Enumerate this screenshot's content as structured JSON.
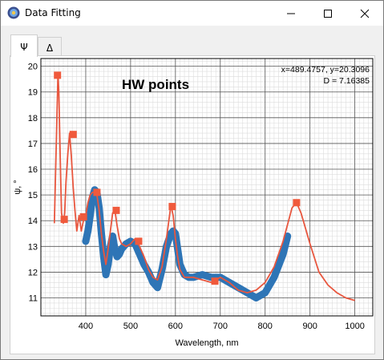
{
  "window": {
    "title": "Data Fitting",
    "icon": "app-icon",
    "controls": {
      "minimize": "minimize-icon",
      "maximize": "maximize-icon",
      "close": "close-icon"
    }
  },
  "tabs": [
    {
      "label": "Ψ",
      "active": true
    },
    {
      "label": "Δ",
      "active": false
    }
  ],
  "plot": {
    "annotation": "HW points",
    "cursor_readout_line1": "x=489.4757, y=20.3096",
    "cursor_readout_line2": "D = 7.16385"
  },
  "chart_data": {
    "type": "line",
    "xlabel": "Wavelength, nm",
    "ylabel": "ψ, °",
    "xlim": [
      300,
      1040
    ],
    "ylim": [
      10.3,
      20.3
    ],
    "xticks": [
      400,
      500,
      600,
      700,
      800,
      900,
      1000
    ],
    "yticks": [
      11,
      12,
      13,
      14,
      15,
      16,
      17,
      18,
      19,
      20
    ],
    "grid": true,
    "colors": {
      "fit": "#e8563e",
      "measured": "#2e75b6",
      "hw_points": "#f05a3c"
    },
    "series": [
      {
        "style": "line",
        "x": [
          330,
          335,
          338,
          340,
          343,
          346,
          350,
          353,
          356,
          360,
          364,
          368,
          372,
          376,
          380,
          385,
          390,
          395,
          400,
          405,
          410,
          415,
          420,
          425,
          430,
          435,
          440,
          445,
          450,
          455,
          460,
          465,
          470,
          475,
          480,
          490,
          500,
          510,
          520,
          530,
          540,
          550,
          560,
          570,
          580,
          590,
          595,
          600,
          605,
          610,
          620,
          630,
          640,
          660,
          680,
          700,
          720,
          740,
          760,
          780,
          800,
          820,
          840,
          860,
          870,
          880,
          900,
          920,
          940,
          960,
          980,
          1000
        ],
        "y": [
          13.9,
          17.5,
          19.7,
          19.0,
          16.5,
          14.3,
          13.9,
          14.3,
          15.5,
          16.6,
          17.4,
          16.5,
          15.3,
          14.4,
          13.6,
          14.2,
          13.6,
          14.0,
          14.2,
          14.7,
          15.0,
          15.1,
          15.1,
          15.0,
          14.4,
          13.5,
          12.8,
          12.3,
          12.9,
          13.6,
          14.3,
          14.4,
          13.8,
          13.3,
          13.1,
          13.0,
          13.1,
          13.3,
          13.0,
          12.6,
          12.1,
          11.8,
          11.7,
          12.2,
          13.3,
          14.6,
          14.2,
          13.3,
          12.6,
          12.1,
          11.8,
          11.8,
          11.8,
          11.7,
          11.6,
          11.8,
          11.6,
          11.3,
          11.2,
          11.3,
          11.6,
          12.2,
          13.2,
          14.5,
          14.7,
          14.3,
          13.1,
          12.0,
          11.5,
          11.2,
          11.0,
          10.9
        ]
      },
      {
        "style": "points",
        "x": [
          400,
          405,
          410,
          415,
          420,
          425,
          430,
          435,
          440,
          445,
          450,
          455,
          460,
          465,
          470,
          475,
          480,
          490,
          500,
          510,
          520,
          530,
          540,
          550,
          560,
          570,
          580,
          590,
          595,
          600,
          605,
          610,
          620,
          630,
          640,
          660,
          680,
          700,
          720,
          740,
          760,
          780,
          800,
          820,
          840,
          850
        ],
        "y": [
          13.2,
          13.6,
          14.2,
          14.9,
          15.2,
          15.1,
          14.5,
          13.5,
          12.6,
          11.9,
          12.3,
          13.0,
          13.4,
          12.9,
          12.6,
          12.7,
          12.9,
          13.1,
          13.2,
          13.1,
          12.7,
          12.3,
          12.0,
          11.6,
          11.4,
          12.1,
          13.0,
          13.5,
          13.6,
          13.5,
          12.9,
          12.3,
          11.9,
          11.8,
          11.8,
          11.9,
          11.8,
          11.8,
          11.6,
          11.4,
          11.2,
          11.0,
          11.2,
          11.8,
          12.7,
          13.4
        ]
      },
      {
        "style": "markers",
        "x": [
          337,
          352,
          372,
          395,
          425,
          468,
          518,
          593,
          688,
          870
        ],
        "y": [
          19.65,
          14.05,
          17.35,
          14.15,
          15.1,
          14.4,
          13.2,
          14.55,
          11.65,
          14.7
        ]
      }
    ]
  }
}
